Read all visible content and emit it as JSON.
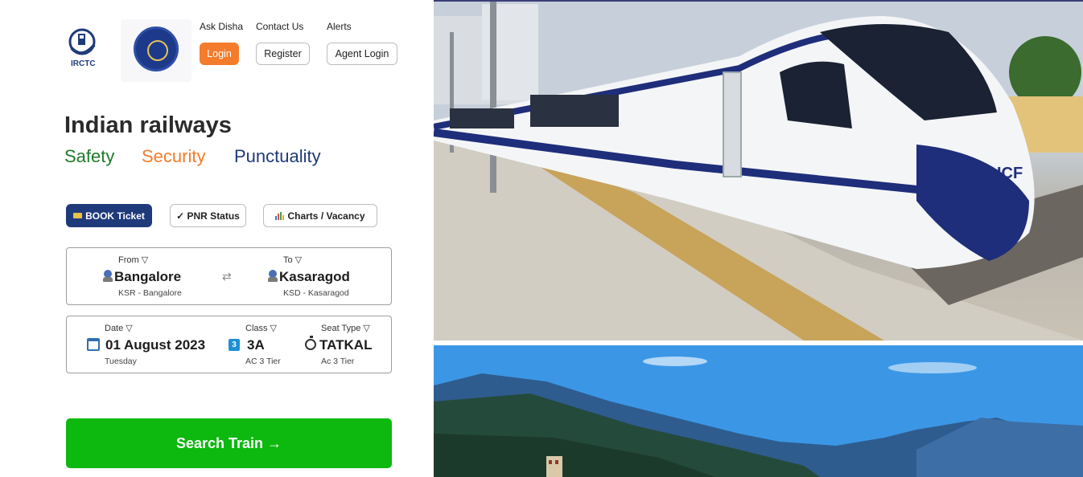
{
  "header": {
    "logo_irctc_text": "IRCTC",
    "links": {
      "ask_disha": "Ask Disha",
      "contact_us": "Contact Us",
      "alerts": "Alerts"
    },
    "buttons": {
      "login": "Login",
      "register": "Register",
      "agent_login": "Agent Login"
    }
  },
  "hero": {
    "title": "Indian railways",
    "tags": {
      "safety": "Safety",
      "security": "Security",
      "punctuality": "Punctuality"
    }
  },
  "tabs": {
    "book": {
      "icon": "ticket-icon",
      "label": "BOOK Ticket"
    },
    "pnr": {
      "icon": "check-icon",
      "label": "✓ PNR Status"
    },
    "charts": {
      "icon": "bar-chart-icon",
      "label": "Charts / Vacancy"
    }
  },
  "journey": {
    "from": {
      "label": "From ▽",
      "station": "Bangalore",
      "code": "KSR - Bangalore"
    },
    "to": {
      "label": "To ▽",
      "station": "Kasaragod",
      "code": "KSD - Kasaragod"
    },
    "swap_icon": "⇄"
  },
  "details": {
    "date": {
      "label": "Date ▽",
      "value": "01 August 2023",
      "sub": "Tuesday"
    },
    "class": {
      "label": "Class ▽",
      "badge": "3",
      "value": "3A",
      "sub": "AC 3 Tier"
    },
    "seat": {
      "label": "Seat Type ▽",
      "value": "TATKAL",
      "sub": "Ac 3 Tier"
    }
  },
  "search_button": "Search Train →",
  "colors": {
    "brand_blue": "#1f3a7a",
    "brand_orange": "#f47c2c",
    "safety_green": "#1f7a2b",
    "search_green": "#0db80f"
  }
}
